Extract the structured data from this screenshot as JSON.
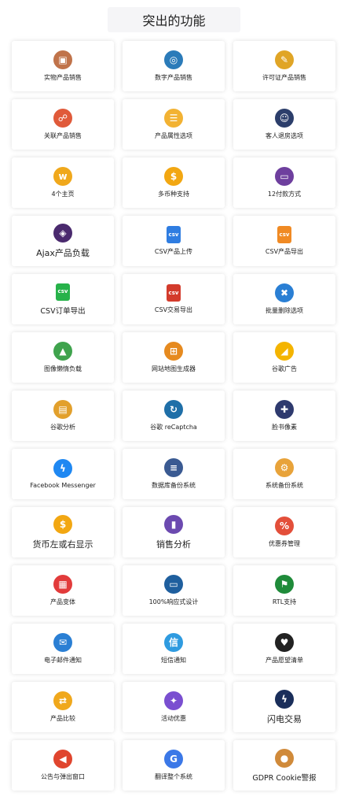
{
  "page": {
    "title": "突出的功能"
  },
  "features": [
    {
      "label": "实物产品销售",
      "icon": "package-icon",
      "color": "#c0734a",
      "glyph": "▣",
      "size": "normal"
    },
    {
      "label": "数字产品销售",
      "icon": "digital-globe-icon",
      "color": "#2b7bb9",
      "glyph": "◎",
      "size": "normal"
    },
    {
      "label": "许可证产品销售",
      "icon": "certificate-icon",
      "color": "#e0a526",
      "glyph": "✎",
      "size": "normal"
    },
    {
      "label": "关联产品销售",
      "icon": "people-network-icon",
      "color": "#e05a3a",
      "glyph": "☍",
      "size": "normal"
    },
    {
      "label": "产品属性选项",
      "icon": "list-options-icon",
      "color": "#f2b233",
      "glyph": "☰",
      "size": "normal"
    },
    {
      "label": "客人退房选项",
      "icon": "guest-avatar-icon",
      "color": "#2c3e6b",
      "glyph": "☺",
      "size": "normal"
    },
    {
      "label": "4个主页",
      "icon": "www-globe-icon",
      "color": "#f0a81c",
      "glyph": "w",
      "size": "normal"
    },
    {
      "label": "多币种支持",
      "icon": "currency-exchange-icon",
      "color": "#f2a712",
      "glyph": "$",
      "size": "normal"
    },
    {
      "label": "12付款方式",
      "icon": "payment-terminal-icon",
      "color": "#6e3f9e",
      "glyph": "▭",
      "size": "normal"
    },
    {
      "label": "Ajax产品负载",
      "icon": "ajax-loader-icon",
      "color": "#4a2a6e",
      "glyph": "◈",
      "size": "big"
    },
    {
      "label": "CSV产品上传",
      "icon": "csv-file-blue-icon",
      "color": "#2f7de1",
      "glyph": "csv",
      "size": "normal"
    },
    {
      "label": "CSV产品导出",
      "icon": "csv-file-orange-icon",
      "color": "#f08a24",
      "glyph": "csv",
      "size": "normal"
    },
    {
      "label": "CSV订单导出",
      "icon": "csv-file-green-icon",
      "color": "#27b24a",
      "glyph": "csv",
      "size": "mid"
    },
    {
      "label": "CSV交易导出",
      "icon": "csv-file-red-icon",
      "color": "#d33b2c",
      "glyph": "csv",
      "size": "normal"
    },
    {
      "label": "批量删除选项",
      "icon": "trash-icon",
      "color": "#2a7fd4",
      "glyph": "✖",
      "size": "normal"
    },
    {
      "label": "图像懒惰负载",
      "icon": "image-icon",
      "color": "#3fa34d",
      "glyph": "▲",
      "size": "normal"
    },
    {
      "label": "网站地图生成器",
      "icon": "sitemap-icon",
      "color": "#e68a1f",
      "glyph": "⊞",
      "size": "normal"
    },
    {
      "label": "谷歌广告",
      "icon": "google-ads-icon",
      "color": "#f4b400",
      "glyph": "◢",
      "size": "normal"
    },
    {
      "label": "谷歌分析",
      "icon": "analytics-board-icon",
      "color": "#e2a02c",
      "glyph": "▤",
      "size": "normal"
    },
    {
      "label": "谷歌 reCaptcha",
      "icon": "recaptcha-icon",
      "color": "#1f6fa8",
      "glyph": "↻",
      "size": "normal"
    },
    {
      "label": "脸书像素",
      "icon": "pixel-icon",
      "color": "#2e3a6e",
      "glyph": "✚",
      "size": "normal"
    },
    {
      "label": "Facebook Messenger",
      "icon": "messenger-icon",
      "color": "#1f88f2",
      "glyph": "ϟ",
      "size": "normal"
    },
    {
      "label": "数据库备份系统",
      "icon": "database-icon",
      "color": "#3a5a92",
      "glyph": "≡",
      "size": "normal"
    },
    {
      "label": "系统备份系统",
      "icon": "system-gear-icon",
      "color": "#e8a33a",
      "glyph": "⚙",
      "size": "normal"
    },
    {
      "label": "货币左或右显示",
      "icon": "coin-icon",
      "color": "#f2a712",
      "glyph": "$",
      "size": "big"
    },
    {
      "label": "销售分析",
      "icon": "sales-chart-icon",
      "color": "#6c4ab0",
      "glyph": "▮",
      "size": "big"
    },
    {
      "label": "优惠券管理",
      "icon": "coupon-icon",
      "color": "#e34f3a",
      "glyph": "%",
      "size": "normal"
    },
    {
      "label": "产品变体",
      "icon": "blocks-icon",
      "color": "#e23b3b",
      "glyph": "▦",
      "size": "normal"
    },
    {
      "label": "100%响应式设计",
      "icon": "responsive-devices-icon",
      "color": "#1f5f9e",
      "glyph": "▭",
      "size": "normal"
    },
    {
      "label": "RTL支持",
      "icon": "uae-flag-icon",
      "color": "#1f8b3a",
      "glyph": "⚑",
      "size": "normal"
    },
    {
      "label": "电子邮件通知",
      "icon": "email-icon",
      "color": "#2a7fd4",
      "glyph": "✉",
      "size": "normal"
    },
    {
      "label": "短信通知",
      "icon": "sms-icon",
      "color": "#2f9be0",
      "glyph": "信",
      "size": "normal"
    },
    {
      "label": "产品愿望清单",
      "icon": "wishlist-cart-icon",
      "color": "#222222",
      "glyph": "♥",
      "size": "normal"
    },
    {
      "label": "产品比较",
      "icon": "compare-icon",
      "color": "#f0a81c",
      "glyph": "⇄",
      "size": "normal"
    },
    {
      "label": "活动优惠",
      "icon": "megaphone-icon",
      "color": "#7a4fd0",
      "glyph": "✦",
      "size": "normal"
    },
    {
      "label": "闪电交易",
      "icon": "flash-icon",
      "color": "#1a2e5a",
      "glyph": "ϟ",
      "size": "big"
    },
    {
      "label": "公告与弹出窗口",
      "icon": "announcement-icon",
      "color": "#e0452e",
      "glyph": "◀",
      "size": "normal"
    },
    {
      "label": "翻译整个系统",
      "icon": "translate-icon",
      "color": "#3b78e7",
      "glyph": "G",
      "size": "normal"
    },
    {
      "label": "GDPR Cookie警报",
      "icon": "cookie-icon",
      "color": "#d08a3a",
      "glyph": "●",
      "size": "mid"
    }
  ]
}
